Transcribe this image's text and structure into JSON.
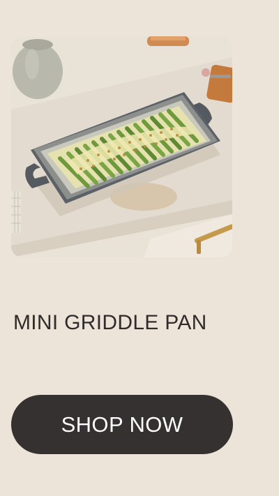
{
  "product": {
    "image_alt": "Mini griddle pan with roasted asparagus on a kitchen counter",
    "title": "MINI GRIDDLE PAN",
    "cta_label": "SHOP NOW"
  },
  "colors": {
    "background": "#ece4d8",
    "button_bg": "#343130",
    "button_text": "#ffffff",
    "title_text": "#2f2c2b",
    "pan": "#5c6168"
  },
  "icons": {
    "product_photo": "griddle-pan-photo"
  }
}
